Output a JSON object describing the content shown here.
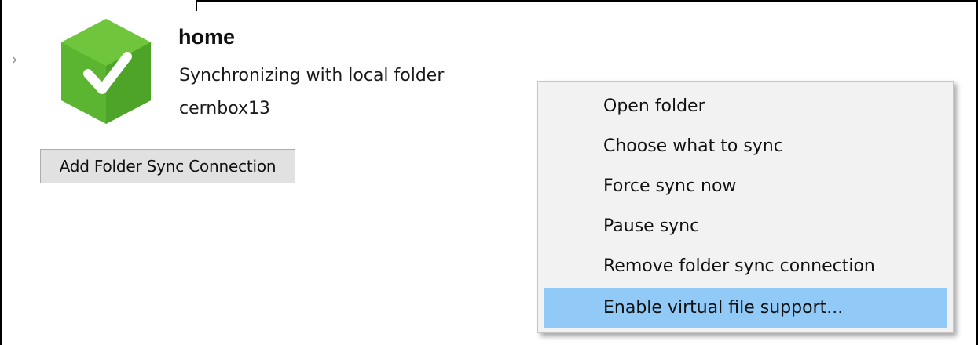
{
  "folder": {
    "name": "home",
    "status": "Synchronizing with local folder",
    "remote": "cernbox13",
    "status_color": "#5cb531"
  },
  "add_button_label": "Add Folder Sync Connection",
  "context_menu": {
    "items": [
      {
        "label": "Open folder"
      },
      {
        "label": "Choose what to sync"
      },
      {
        "label": "Force sync now"
      },
      {
        "label": "Pause sync"
      },
      {
        "label": "Remove folder sync connection"
      },
      {
        "label": "Enable virtual file support..."
      }
    ],
    "highlight_color": "#91c9f7"
  },
  "icons": {
    "expand": "chevron-right-icon",
    "folder_status": "sync-ok-checkmark-icon"
  }
}
